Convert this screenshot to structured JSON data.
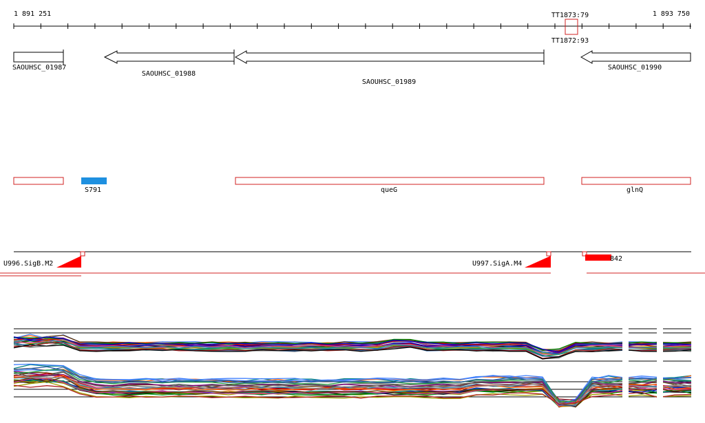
{
  "coordinates": {
    "start_label": "1 891 251",
    "end_label": "1 893 750",
    "terminator_top_label": "TT1873:79",
    "terminator_bottom_label": "TT1872:93"
  },
  "genes": {
    "gene_1987": "SAOUHSC_01987",
    "gene_1988": "SAOUHSC_01988",
    "gene_1989": "SAOUHSC_01989",
    "gene_1990": "SAOUHSC_01990"
  },
  "features": {
    "s791": "S791",
    "queg": "queG",
    "glnq": "glnQ"
  },
  "transcription": {
    "u996": "U996.SigB.M2",
    "u997": "U997.SigA.M4",
    "u842": "U842",
    "u842_visible": "842"
  },
  "colors": {
    "feature_outline": "#d02020",
    "srna_fill": "#1e90e0",
    "promoter_fill": "#ff0000",
    "axis": "#000000"
  }
}
